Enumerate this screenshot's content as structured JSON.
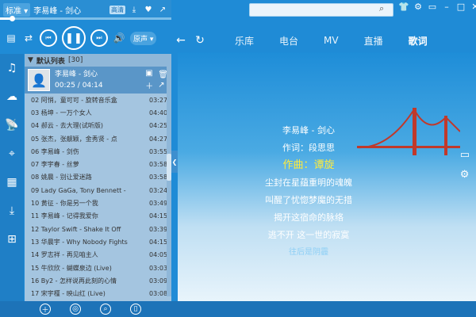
{
  "topbar": {
    "quality": "标准 ▾",
    "song": "李易峰 - 剑心",
    "mv": "高清"
  },
  "controls": {
    "mode": "原声 ▾"
  },
  "search": {
    "placeholder": ""
  },
  "nav": {
    "tabs": [
      "乐库",
      "电台",
      "MV",
      "直播",
      "歌词"
    ],
    "active": 4
  },
  "playlist": {
    "name": "默认列表",
    "count": "[30]",
    "now": {
      "title": "李易峰 - 剑心",
      "time": "00:25 / 04:14"
    },
    "rows": [
      {
        "t": "02 阿悄，童可可 - 旋转音乐盒",
        "d": "03:27"
      },
      {
        "t": "03 杨坤 - 一万个女人",
        "d": "04:40"
      },
      {
        "t": "04 郝云 - 去大理(试听版)",
        "d": "04:25"
      },
      {
        "t": "05 张杰，张靓颖，金秀贤 - 点",
        "d": "04:27"
      },
      {
        "t": "06 李易峰 - 剑伤",
        "d": "03:55"
      },
      {
        "t": "07 李宇春 - 丝萝",
        "d": "03:58"
      },
      {
        "t": "08 姚晨 - 别让爱迷路",
        "d": "03:58"
      },
      {
        "t": "09 Lady GaGa, Tony Bennett -",
        "d": "03:24"
      },
      {
        "t": "10 黄征 - 你是另一个我",
        "d": "03:49"
      },
      {
        "t": "11 李易峰 - 记得我爱你",
        "d": "04:15"
      },
      {
        "t": "12 Taylor Swift - Shake It Off",
        "d": "03:39"
      },
      {
        "t": "13 华晨宇 - Why Nobody Fights",
        "d": "04:15"
      },
      {
        "t": "14 罗志祥 - 再见咱主人",
        "d": "04:05"
      },
      {
        "t": "15 牛欣欣 - 蝴蝶泉边 (Live)",
        "d": "03:03"
      },
      {
        "t": "16 By2 - 怎样说再此刻的心情",
        "d": "03:09"
      },
      {
        "t": "17 宋宇槿 - 映山红 (Live)",
        "d": "03:08"
      }
    ]
  },
  "lyrics": {
    "lines": [
      "李易峰 - 剑心",
      "作词：段思思",
      "作曲：谭旋",
      "尘封在星蕴重明的魂魄",
      "叫醒了忧惚梦魔的无措",
      "揭开这宿命的脉络",
      "逃不开 这一世的寂寞",
      "往后是阴霾"
    ]
  },
  "colors": {
    "accent": "#1f8bd6",
    "highlight": "#ffeb3b"
  }
}
